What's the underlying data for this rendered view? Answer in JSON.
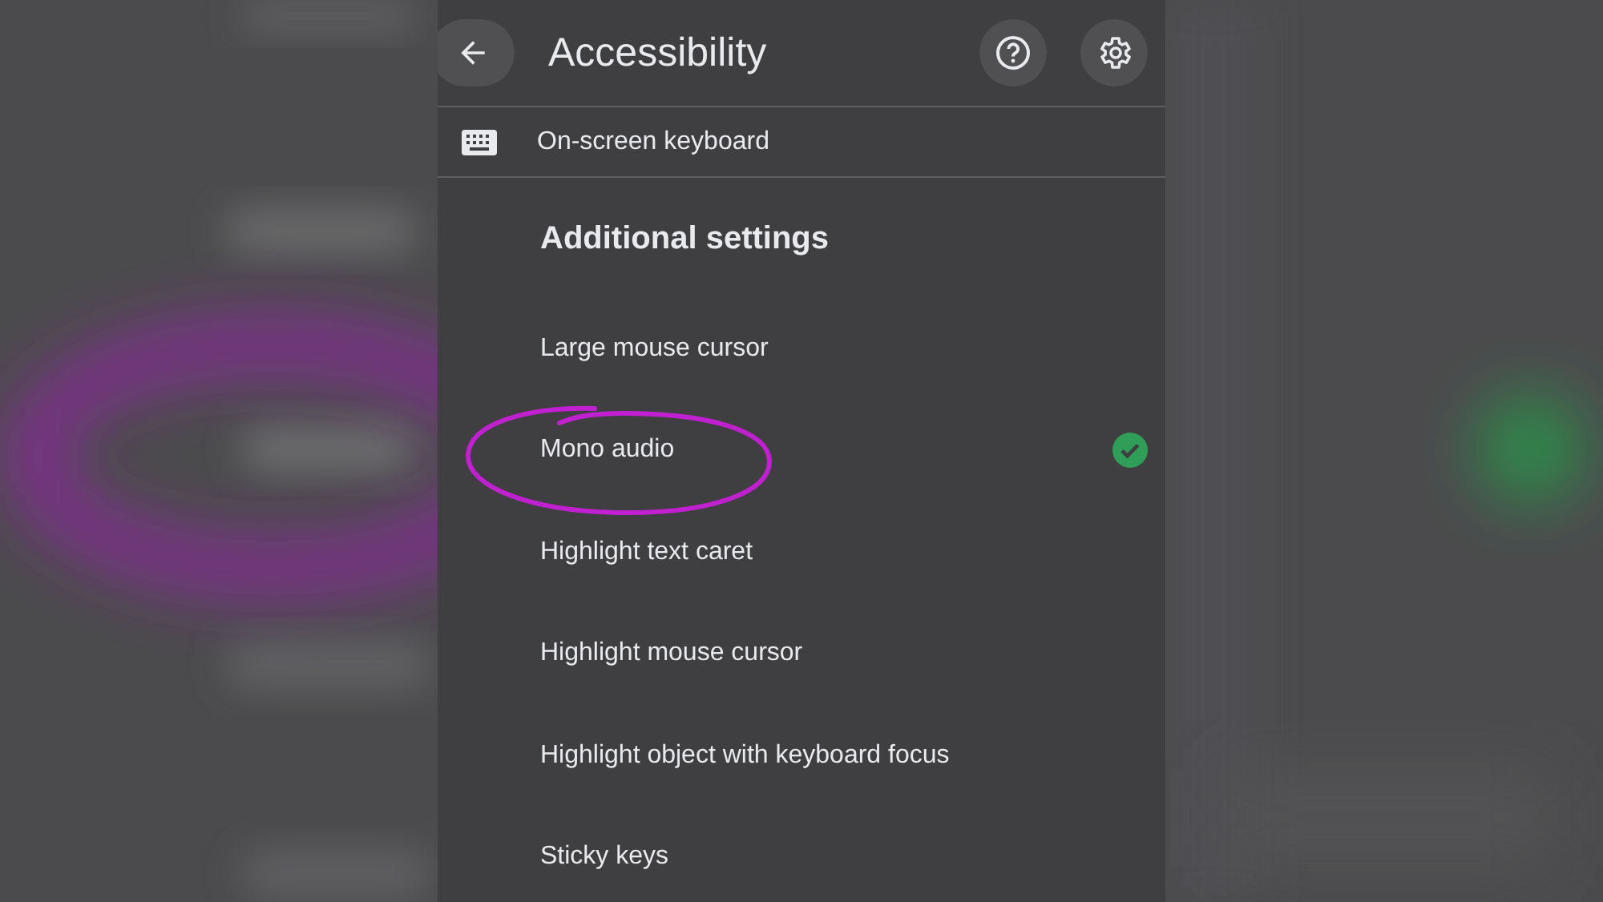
{
  "header": {
    "title": "Accessibility"
  },
  "partial_item": {
    "label": "On-screen keyboard"
  },
  "section": {
    "title": "Additional settings"
  },
  "items": [
    {
      "label": "Large mouse cursor",
      "checked": false,
      "annotated": false
    },
    {
      "label": "Mono audio",
      "checked": true,
      "annotated": true
    },
    {
      "label": "Highlight text caret",
      "checked": false,
      "annotated": false
    },
    {
      "label": "Highlight mouse cursor",
      "checked": false,
      "annotated": false
    },
    {
      "label": "Highlight object with keyboard focus",
      "checked": false,
      "annotated": false
    },
    {
      "label": "Sticky keys",
      "checked": false,
      "annotated": false
    }
  ]
}
